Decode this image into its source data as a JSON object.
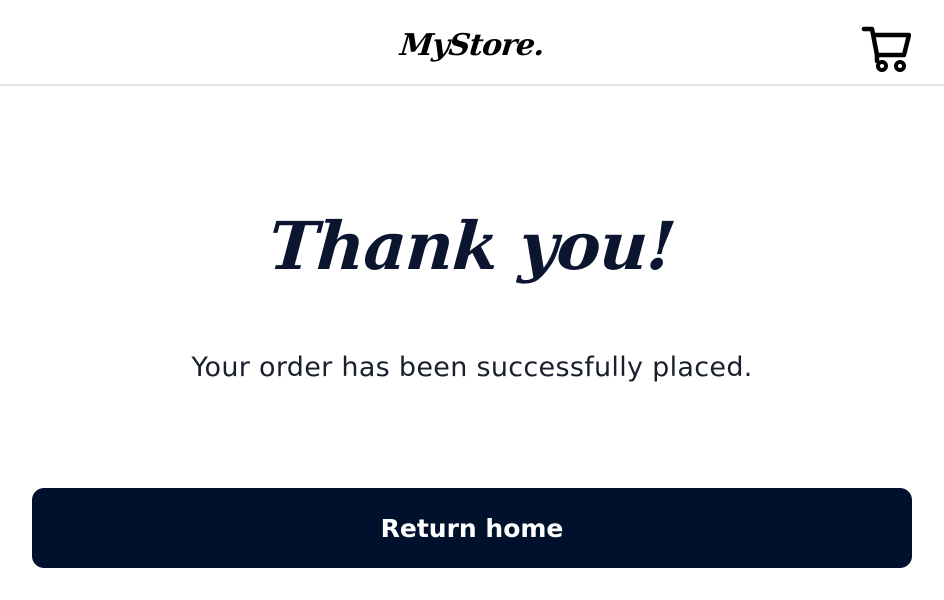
{
  "header": {
    "logo_text": "MyStore.",
    "cart_icon": "shopping-cart-icon"
  },
  "main": {
    "title": "Thank you!",
    "message": "Your order has been successfully placed.",
    "return_button_label": "Return home"
  },
  "colors": {
    "primary": "#00122b",
    "title_text": "#0b1530",
    "body_text": "#1a1f2e",
    "header_border": "#e3e3e3",
    "background": "#ffffff"
  }
}
